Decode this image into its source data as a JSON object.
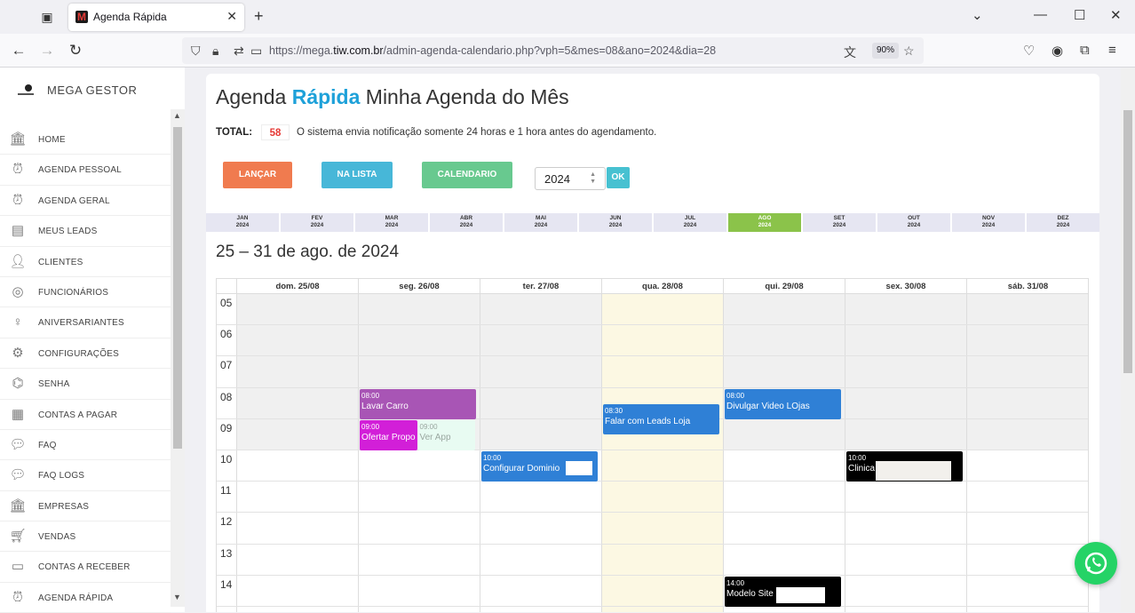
{
  "browser": {
    "tab_title": "Agenda Rápida",
    "url_prefix": "https://mega.",
    "url_host": "tiw.com.br",
    "url_path": "/admin-agenda-calendario.php?vph=5&mes=08&ano=2024&dia=28",
    "zoom": "90%"
  },
  "sidebar": {
    "brand": "MEGA GESTOR",
    "items": [
      {
        "label": "HOME",
        "icon": "bank-icon"
      },
      {
        "label": "AGENDA PESSOAL",
        "icon": "alarm-clock-icon"
      },
      {
        "label": "AGENDA GERAL",
        "icon": "alarm-clock-icon"
      },
      {
        "label": "MEUS LEADS",
        "icon": "id-card-icon"
      },
      {
        "label": "CLIENTES",
        "icon": "user-icon"
      },
      {
        "label": "FUNCIONÁRIOS",
        "icon": "user-circle-icon"
      },
      {
        "label": "ANIVERSARIANTES",
        "icon": "balloon-icon"
      },
      {
        "label": "CONFIGURAÇÕES",
        "icon": "gear-icon"
      },
      {
        "label": "SENHA",
        "icon": "fingerprint-icon"
      },
      {
        "label": "CONTAS A PAGAR",
        "icon": "invoice-icon"
      },
      {
        "label": "FAQ",
        "icon": "chat-bubble-icon"
      },
      {
        "label": "FAQ LOGS",
        "icon": "chat-bubble-icon"
      },
      {
        "label": "EMPRESAS",
        "icon": "bank-icon"
      },
      {
        "label": "VENDAS",
        "icon": "cart-icon"
      },
      {
        "label": "CONTAS A RECEBER",
        "icon": "card-icon"
      },
      {
        "label": "AGENDA RÁPIDA",
        "icon": "alarm-clock-icon"
      }
    ]
  },
  "page": {
    "title_prefix": "Agenda",
    "title_accent": "Rápida",
    "title_suffix": "Minha Agenda do Mês",
    "total_label": "TOTAL:",
    "total_value": "58",
    "notice": "O sistema envia notificação somente 24 horas e 1 hora antes do agendamento.",
    "btn_lancar": "LANÇAR",
    "btn_lista": "NA LISTA",
    "btn_calendario": "CALENDARIO",
    "year": "2024",
    "btn_ok": "OK",
    "months": [
      {
        "m": "JAN",
        "y": "2024"
      },
      {
        "m": "FEV",
        "y": "2024"
      },
      {
        "m": "MAR",
        "y": "2024"
      },
      {
        "m": "ABR",
        "y": "2024"
      },
      {
        "m": "MAI",
        "y": "2024"
      },
      {
        "m": "JUN",
        "y": "2024"
      },
      {
        "m": "JUL",
        "y": "2024"
      },
      {
        "m": "AGO",
        "y": "2024"
      },
      {
        "m": "SET",
        "y": "2024"
      },
      {
        "m": "OUT",
        "y": "2024"
      },
      {
        "m": "NOV",
        "y": "2024"
      },
      {
        "m": "DEZ",
        "y": "2024"
      }
    ],
    "active_month": "AGO",
    "week_title": "25 – 31 de ago. de 2024"
  },
  "calendar": {
    "days": [
      "dom. 25/08",
      "seg. 26/08",
      "ter. 27/08",
      "qua. 28/08",
      "qui. 29/08",
      "sex. 30/08",
      "sáb. 31/08"
    ],
    "today_index": 3,
    "hours": [
      "05",
      "06",
      "07",
      "08",
      "09",
      "10",
      "11",
      "12",
      "13",
      "14"
    ],
    "events": [
      {
        "day": 1,
        "time": "08:00",
        "title": "Lavar Carro",
        "color": "#a855b5"
      },
      {
        "day": 1,
        "time": "09:00",
        "title": "Ofertar Propo",
        "color": "#d21fd8"
      },
      {
        "day": 1,
        "time": "09:00",
        "title": "Ver App",
        "color": "#e8fbf2",
        "text_color": "#9aa7a0"
      },
      {
        "day": 2,
        "time": "10:00",
        "title": "Configurar Dominio",
        "color": "#2f80d6"
      },
      {
        "day": 3,
        "time": "08:30",
        "title": "Falar com Leads Loja",
        "color": "#2f80d6"
      },
      {
        "day": 4,
        "time": "08:00",
        "title": "Divulgar Video LOjas",
        "color": "#2f80d6"
      },
      {
        "day": 5,
        "time": "10:00",
        "title": "Clinica",
        "color": "#000000"
      },
      {
        "day": 4,
        "time": "14:00",
        "title": "Modelo Site",
        "color": "#000000"
      }
    ]
  }
}
